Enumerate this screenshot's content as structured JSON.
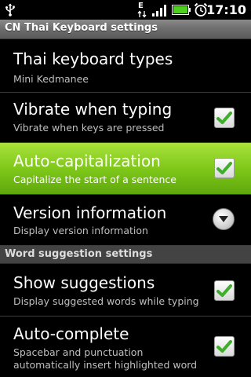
{
  "status_bar": {
    "time": "17:10",
    "icons": [
      "usb-icon",
      "edge-data-icon",
      "signal-icon",
      "battery-icon",
      "alarm-icon"
    ],
    "edge_label": "E"
  },
  "title_bar": {
    "title": "CN Thai Keyboard settings"
  },
  "settings": [
    {
      "title": "Thai keyboard types",
      "summary": "Mini Kedmanee",
      "widget": "none"
    },
    {
      "title": "Vibrate when typing",
      "summary": "Vibrate when keys are pressed",
      "widget": "checkbox",
      "checked": true
    },
    {
      "title": "Auto-capitalization",
      "summary": "Capitalize the start of a sentence",
      "widget": "checkbox",
      "checked": true,
      "selected": true
    },
    {
      "title": "Version information",
      "summary": "Display version information",
      "widget": "dropdown"
    }
  ],
  "category": {
    "title": "Word suggestion settings"
  },
  "suggestion_settings": [
    {
      "title": "Show suggestions",
      "summary": "Display suggested words while typing",
      "widget": "checkbox",
      "checked": true
    },
    {
      "title": "Auto-complete",
      "summary_line1": "Spacebar and punctuation",
      "summary_line2": "automatically insert highlighted word",
      "widget": "checkbox",
      "checked": true
    }
  ],
  "colors": {
    "selected_green": "#7fc81a",
    "check_green": "#3fae2a",
    "background": "#000000",
    "title_bar": "#707070"
  }
}
